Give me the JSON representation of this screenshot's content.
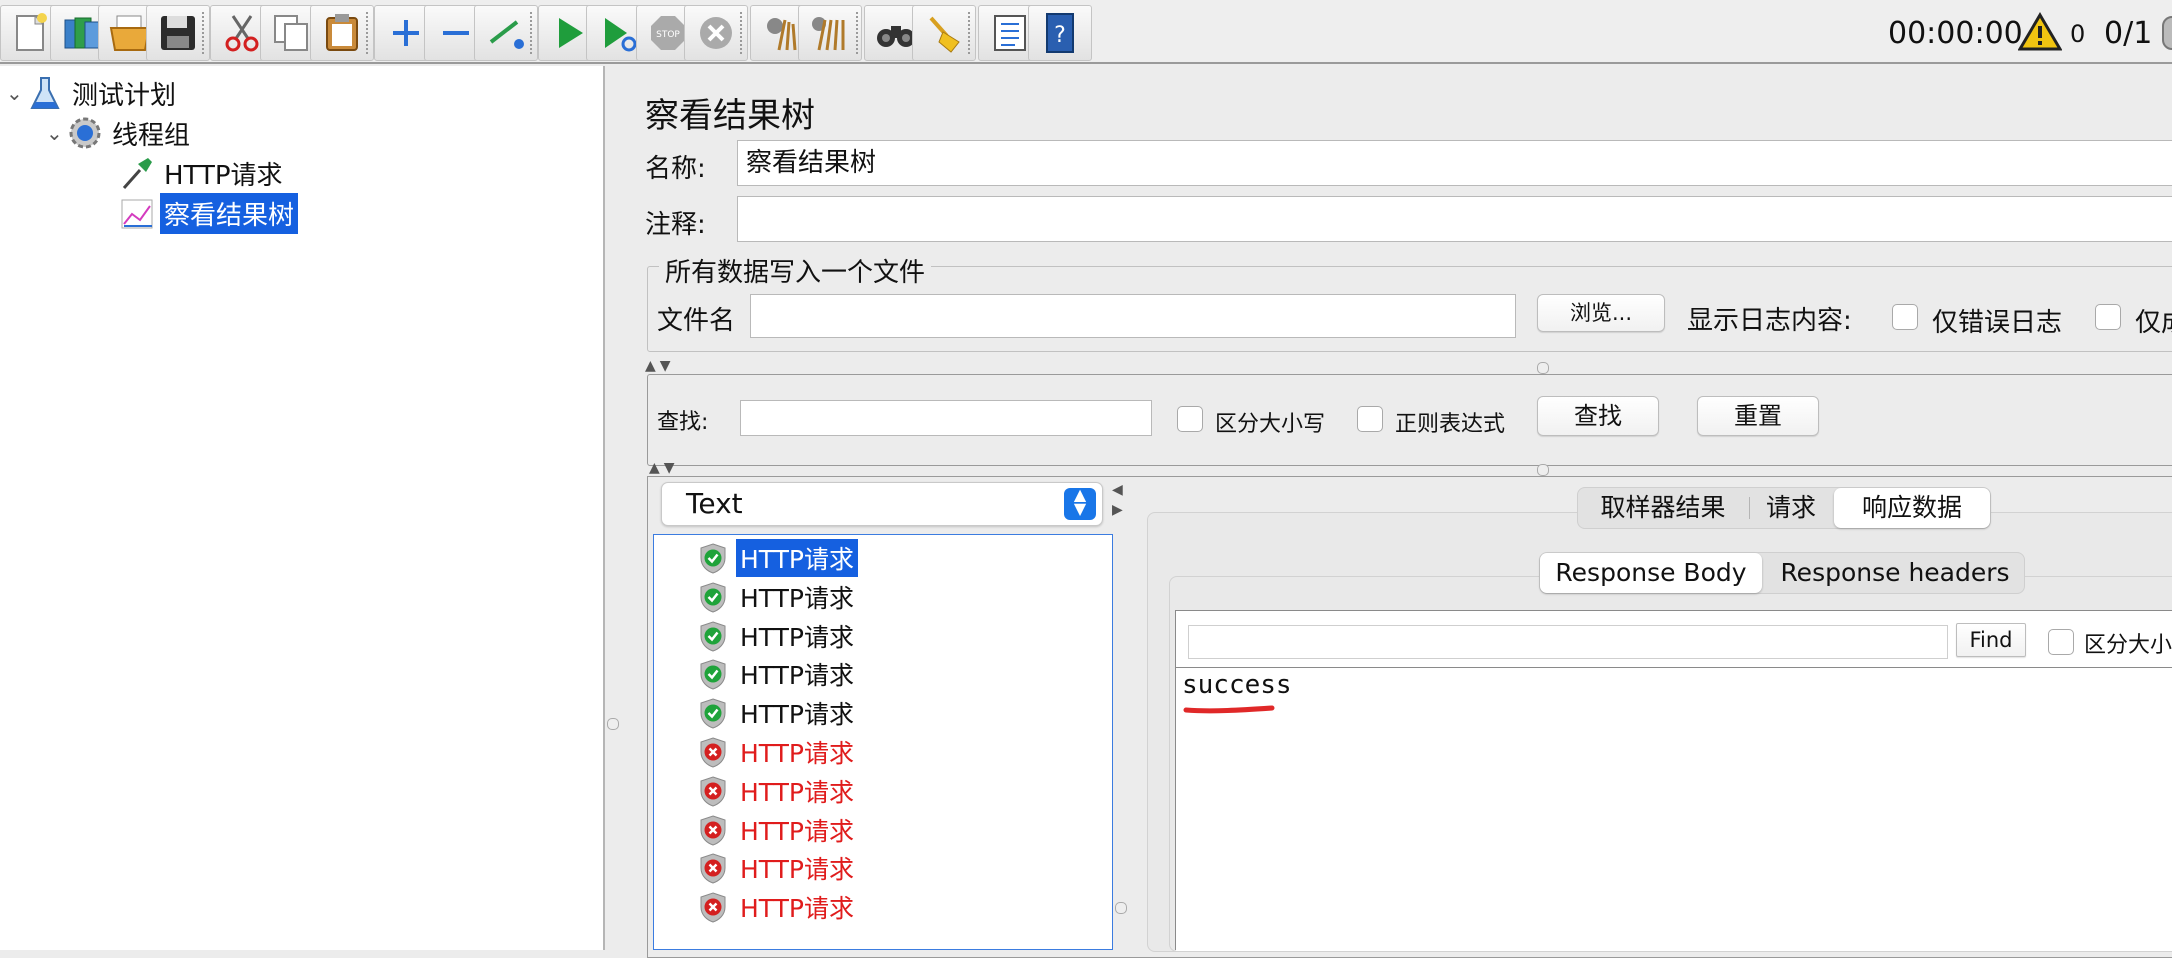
{
  "toolbar": {
    "buttons": [
      {
        "name": "new-icon"
      },
      {
        "name": "templates-icon"
      },
      {
        "name": "open-icon"
      },
      {
        "name": "save-icon"
      },
      {
        "name": "cut-icon"
      },
      {
        "name": "copy-icon"
      },
      {
        "name": "paste-icon"
      },
      {
        "name": "expand-icon"
      },
      {
        "name": "collapse-icon"
      },
      {
        "name": "toggle-icon"
      },
      {
        "name": "start-icon"
      },
      {
        "name": "start-no-pause-icon"
      },
      {
        "name": "stop-icon"
      },
      {
        "name": "shutdown-icon"
      },
      {
        "name": "clear-icon"
      },
      {
        "name": "clear-all-icon"
      },
      {
        "name": "search-icon"
      },
      {
        "name": "reset-search-icon"
      },
      {
        "name": "function-helper-icon"
      },
      {
        "name": "help-icon"
      }
    ],
    "timer": "00:00:00",
    "warnings": "0",
    "threads": "0/1"
  },
  "tree": {
    "test_plan": "测试计划",
    "thread_group": "线程组",
    "http_request": "HTTP请求",
    "result_tree": "察看结果树"
  },
  "panel": {
    "title": "察看结果树",
    "name_label": "名称:",
    "name_value": "察看结果树",
    "comment_label": "注释:",
    "comment_value": "",
    "file_group_title": "所有数据写入一个文件",
    "filename_label": "文件名",
    "filename_value": "",
    "browse_button": "浏览...",
    "log_label": "显示日志内容:",
    "errors_only": "仅错误日志",
    "success_only": "仅成功日志"
  },
  "search": {
    "label": "查找:",
    "value": "",
    "case_sensitive": "区分大小写",
    "regex": "正则表达式",
    "find_button": "查找",
    "reset_button": "重置"
  },
  "renderer": {
    "selected": "Text"
  },
  "results": [
    {
      "label": "HTTP请求",
      "status": "success",
      "selected": true
    },
    {
      "label": "HTTP请求",
      "status": "success",
      "selected": false
    },
    {
      "label": "HTTP请求",
      "status": "success",
      "selected": false
    },
    {
      "label": "HTTP请求",
      "status": "success",
      "selected": false
    },
    {
      "label": "HTTP请求",
      "status": "success",
      "selected": false
    },
    {
      "label": "HTTP请求",
      "status": "error",
      "selected": false
    },
    {
      "label": "HTTP请求",
      "status": "error",
      "selected": false
    },
    {
      "label": "HTTP请求",
      "status": "error",
      "selected": false
    },
    {
      "label": "HTTP请求",
      "status": "error",
      "selected": false
    },
    {
      "label": "HTTP请求",
      "status": "error",
      "selected": false
    }
  ],
  "tabs": {
    "sampler_result": "取样器结果",
    "request": "请求",
    "response_data": "响应数据",
    "active": "响应数据"
  },
  "subtabs": {
    "body": "Response Body",
    "headers": "Response headers",
    "active": "Response Body"
  },
  "response": {
    "find_value": "",
    "find_button": "Find",
    "case_sensitive": "区分大小写",
    "body": "success"
  },
  "colors": {
    "selection": "#1560e0",
    "error_text": "#e01c1c",
    "success_shield": "#1fa33a",
    "error_shield": "#d42020",
    "annotation": "#e02828"
  }
}
